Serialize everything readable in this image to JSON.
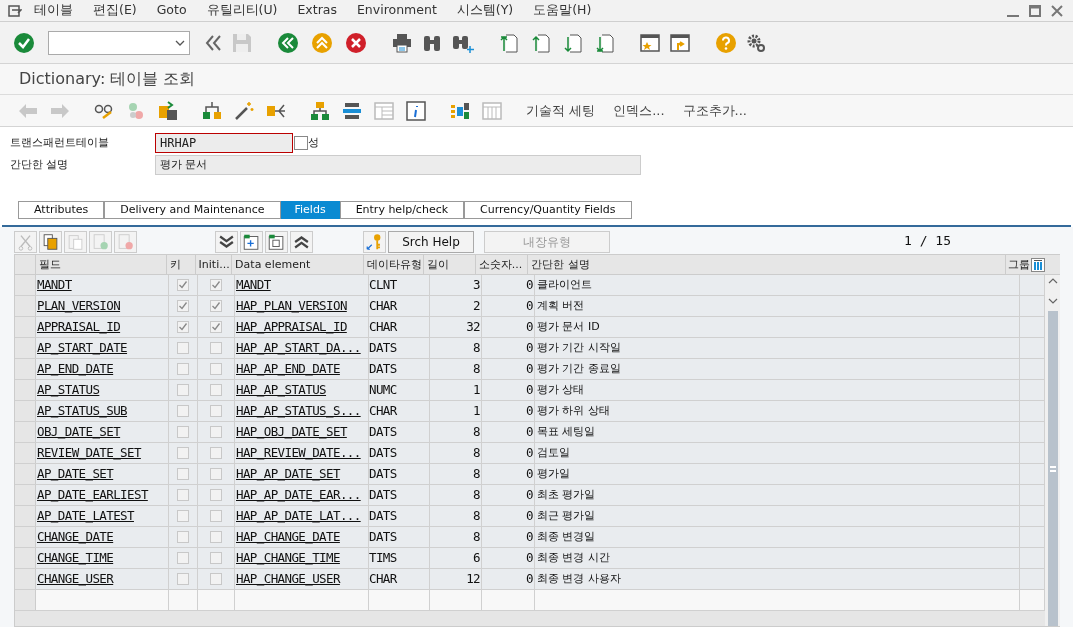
{
  "menu": [
    "테이블",
    "편집(E)",
    "Goto",
    "유틸리티(U)",
    "Extras",
    "Environment",
    "시스템(Y)",
    "도움말(H)"
  ],
  "title": "Dictionary: 테이블 조회",
  "app_toolbar": {
    "buttons": [
      "기술적 세팅",
      "인덱스...",
      "구조추가..."
    ]
  },
  "form": {
    "rows": [
      {
        "label": "트랜스패런트테이블",
        "value": "HRHAP",
        "trailing": "성"
      },
      {
        "label": "간단한 설명",
        "value": "평가 문서"
      }
    ]
  },
  "tabs": [
    {
      "label": "Attributes",
      "selected": false
    },
    {
      "label": "Delivery and Maintenance",
      "selected": false
    },
    {
      "label": "Fields",
      "selected": true
    },
    {
      "label": "Entry help/check",
      "selected": false
    },
    {
      "label": "Currency/Quantity Fields",
      "selected": false
    }
  ],
  "table_toolbar": {
    "buttons": [
      {
        "label": "Srch Help",
        "disabled": false
      },
      {
        "label": "내장유형",
        "disabled": true
      }
    ],
    "page": "1 / 15"
  },
  "table": {
    "columns": [
      "필드",
      "키",
      "Initi...",
      "Data element",
      "데이타유형",
      "길이",
      "소숫자...",
      "간단한 설명",
      "그룹"
    ],
    "rows": [
      {
        "field": "MANDT",
        "key": true,
        "initial": true,
        "data_element": "MANDT",
        "data_type": "CLNT",
        "length": "3",
        "decimals": "0",
        "description": "클라이언트"
      },
      {
        "field": "PLAN_VERSION",
        "key": true,
        "initial": true,
        "data_element": "HAP_PLAN_VERSION",
        "data_type": "CHAR",
        "length": "2",
        "decimals": "0",
        "description": "계획 버전"
      },
      {
        "field": "APPRAISAL_ID",
        "key": true,
        "initial": true,
        "data_element": "HAP_APPRAISAL_ID",
        "data_type": "CHAR",
        "length": "32",
        "decimals": "0",
        "description": "평가 문서 ID"
      },
      {
        "field": "AP_START_DATE",
        "key": false,
        "initial": false,
        "data_element": "HAP_AP_START_DA...",
        "data_type": "DATS",
        "length": "8",
        "decimals": "0",
        "description": "평가 기간 시작일"
      },
      {
        "field": "AP_END_DATE",
        "key": false,
        "initial": false,
        "data_element": "HAP_AP_END_DATE",
        "data_type": "DATS",
        "length": "8",
        "decimals": "0",
        "description": "평가 기간 종료일"
      },
      {
        "field": "AP_STATUS",
        "key": false,
        "initial": false,
        "data_element": "HAP_AP_STATUS",
        "data_type": "NUMC",
        "length": "1",
        "decimals": "0",
        "description": "평가 상태"
      },
      {
        "field": "AP_STATUS_SUB",
        "key": false,
        "initial": false,
        "data_element": "HAP_AP_STATUS_S...",
        "data_type": "CHAR",
        "length": "1",
        "decimals": "0",
        "description": "평가 하위 상태"
      },
      {
        "field": "OBJ_DATE_SET",
        "key": false,
        "initial": false,
        "data_element": "HAP_OBJ_DATE_SET",
        "data_type": "DATS",
        "length": "8",
        "decimals": "0",
        "description": "목표 세팅일"
      },
      {
        "field": "REVIEW_DATE_SET",
        "key": false,
        "initial": false,
        "data_element": "HAP_REVIEW_DATE...",
        "data_type": "DATS",
        "length": "8",
        "decimals": "0",
        "description": "검토일"
      },
      {
        "field": "AP_DATE_SET",
        "key": false,
        "initial": false,
        "data_element": "HAP_AP_DATE_SET",
        "data_type": "DATS",
        "length": "8",
        "decimals": "0",
        "description": "평가일"
      },
      {
        "field": "AP_DATE_EARLIEST",
        "key": false,
        "initial": false,
        "data_element": "HAP_AP_DATE_EAR...",
        "data_type": "DATS",
        "length": "8",
        "decimals": "0",
        "description": "최초 평가일"
      },
      {
        "field": "AP_DATE_LATEST",
        "key": false,
        "initial": false,
        "data_element": "HAP_AP_DATE_LAT...",
        "data_type": "DATS",
        "length": "8",
        "decimals": "0",
        "description": "최근 평가일"
      },
      {
        "field": "CHANGE_DATE",
        "key": false,
        "initial": false,
        "data_element": "HAP_CHANGE_DATE",
        "data_type": "DATS",
        "length": "8",
        "decimals": "0",
        "description": "최종 변경일"
      },
      {
        "field": "CHANGE_TIME",
        "key": false,
        "initial": false,
        "data_element": "HAP_CHANGE_TIME",
        "data_type": "TIMS",
        "length": "6",
        "decimals": "0",
        "description": "최종 변경 시간"
      },
      {
        "field": "CHANGE_USER",
        "key": false,
        "initial": false,
        "data_element": "HAP_CHANGE_USER",
        "data_type": "CHAR",
        "length": "12",
        "decimals": "0",
        "description": "최종 변경 사용자"
      }
    ]
  }
}
